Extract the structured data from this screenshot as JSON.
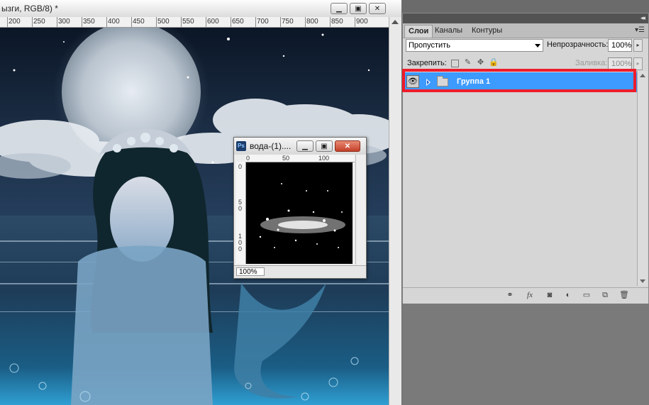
{
  "document": {
    "title": "ызги, RGB/8) *",
    "ruler_labels": [
      "200",
      "250",
      "300",
      "350",
      "400",
      "450",
      "500",
      "550",
      "600",
      "650",
      "700",
      "750",
      "800",
      "850",
      "900"
    ]
  },
  "small_window": {
    "app_badge": "Ps",
    "title": "вода-(1)....",
    "ruler_top": [
      "0",
      "50",
      "100"
    ],
    "ruler_left": [
      "0",
      "5",
      "0",
      "1",
      "0",
      "0"
    ],
    "zoom": "100%"
  },
  "layers_panel": {
    "tabs": [
      "Слои",
      "Каналы",
      "Контуры"
    ],
    "blend_mode": "Пропустить",
    "opacity_label": "Непрозрачность:",
    "opacity_value": "100%",
    "lock_label": "Закрепить:",
    "fill_label": "Заливка:",
    "fill_value": "100%",
    "layers": [
      {
        "name": "Группа 1",
        "visible": true,
        "type": "group",
        "selected": true
      }
    ],
    "highlight_color": "#ee1c2b",
    "selection_color": "#3d9bff"
  }
}
